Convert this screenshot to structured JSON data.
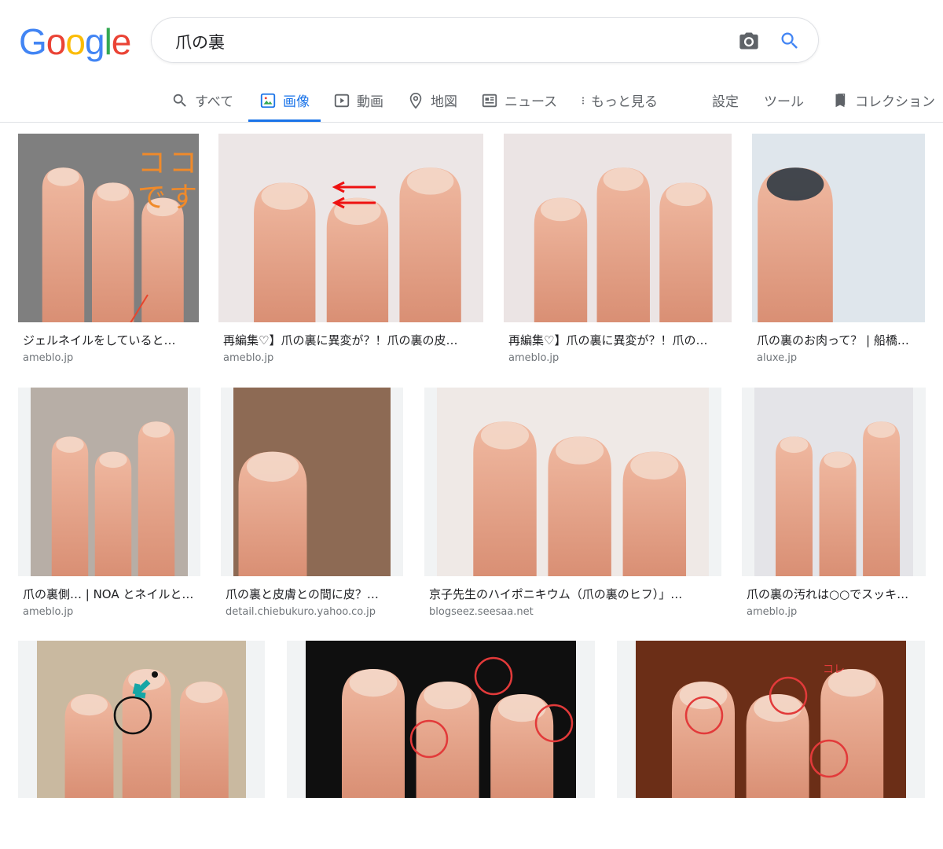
{
  "logo": {
    "letters": [
      "G",
      "o",
      "o",
      "g",
      "l",
      "e"
    ],
    "colors": [
      "#4285F4",
      "#EA4335",
      "#FBBC05",
      "#4285F4",
      "#34A853",
      "#EA4335"
    ]
  },
  "search": {
    "query": "爪の裏"
  },
  "tabs": [
    {
      "label": "すべて",
      "icon": "search-icon"
    },
    {
      "label": "画像",
      "icon": "image-icon"
    },
    {
      "label": "動画",
      "icon": "video-icon"
    },
    {
      "label": "地図",
      "icon": "map-pin-icon"
    },
    {
      "label": "ニュース",
      "icon": "news-icon"
    },
    {
      "label": "もっと見る",
      "icon": "more-vert-icon"
    },
    {
      "label": "設定"
    },
    {
      "label": "ツール"
    },
    {
      "label": "コレクション",
      "icon": "bookmark-icon"
    }
  ],
  "results": [
    {
      "caption": "ジェルネイルをしていると…",
      "source": "ameblo.jp",
      "overlay_text": "ココです"
    },
    {
      "caption": "再編集♡】爪の裏に異変が？！爪の裏の皮…",
      "source": "ameblo.jp"
    },
    {
      "caption": "再編集♡】爪の裏に異変が？！爪の…",
      "source": "ameblo.jp"
    },
    {
      "caption": "爪の裏のお肉って？ | 船橋…",
      "source": "aluxe.jp"
    },
    {
      "caption": "爪の裏側… | NOA とネイルと…",
      "source": "ameblo.jp"
    },
    {
      "caption": "爪の裏と皮膚との間に皮？…",
      "source": "detail.chiebukuro.yahoo.co.jp"
    },
    {
      "caption": "京子先生のハイポニキウム（爪の裏のヒフ）」…",
      "source": "blogseez.seesaa.net"
    },
    {
      "caption": "爪の裏の汚れは○○でスッキ…",
      "source": "ameblo.jp"
    },
    {
      "caption": "",
      "source": ""
    },
    {
      "caption": "",
      "source": ""
    },
    {
      "caption": "",
      "source": "",
      "overlay_text": "コレ"
    }
  ],
  "colors": {
    "accent": "#1a73e8",
    "skin": "#e9a58c",
    "nail": "#f3d7c8"
  }
}
